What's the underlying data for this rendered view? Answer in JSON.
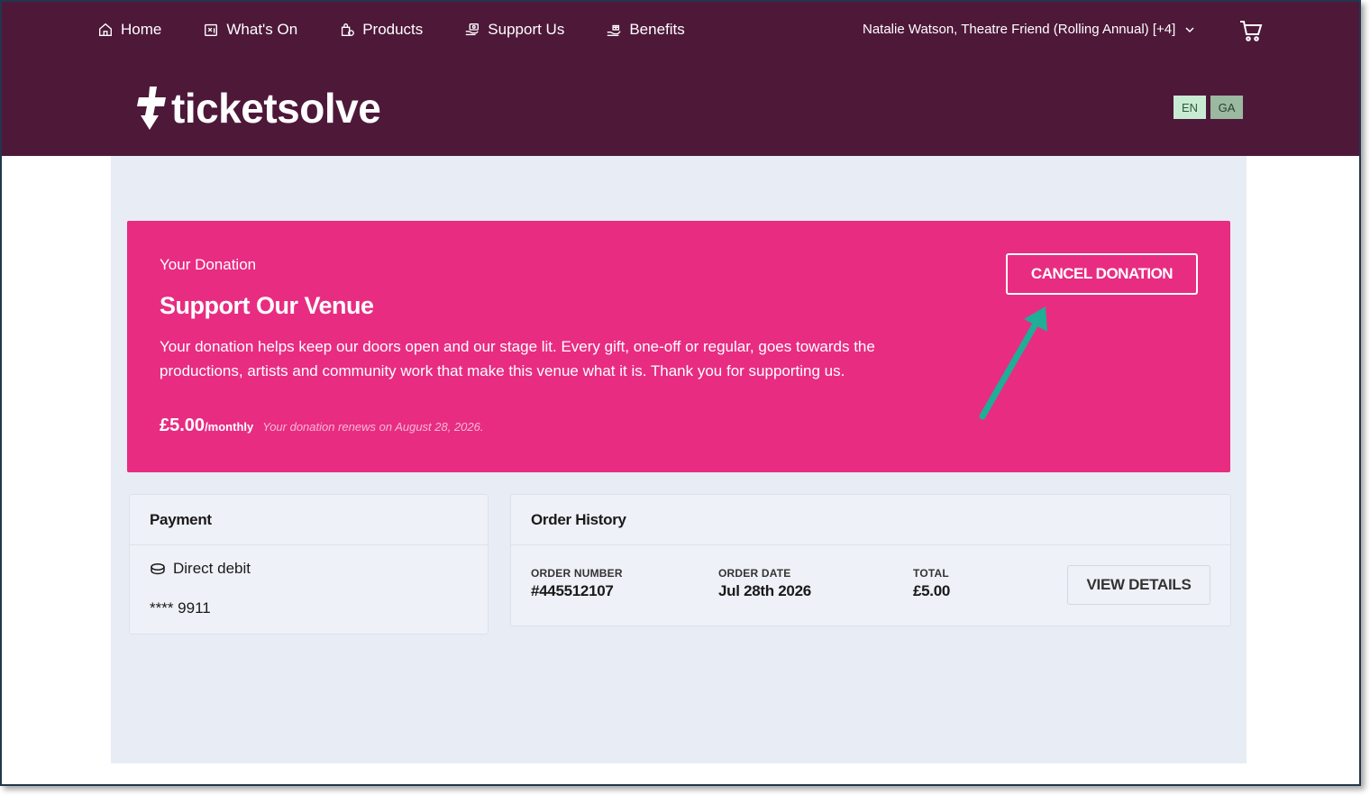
{
  "nav": {
    "items": [
      {
        "label": "Home",
        "icon": "home-icon"
      },
      {
        "label": "What's On",
        "icon": "calendar-icon"
      },
      {
        "label": "Products",
        "icon": "shopping-bag-icon"
      },
      {
        "label": "Support Us",
        "icon": "donate-icon"
      },
      {
        "label": "Benefits",
        "icon": "gift-hand-icon"
      }
    ],
    "user": "Natalie Watson, Theatre Friend (Rolling Annual) [+4]",
    "cart_icon": "cart-icon"
  },
  "brand": {
    "name": "ticketsolve",
    "header_bg": "#4e1839"
  },
  "languages": [
    "EN",
    "GA"
  ],
  "donation": {
    "label": "Your Donation",
    "title": "Support Our Venue",
    "description": "Your donation helps keep our doors open and our stage lit. Every gift, one-off or regular, goes towards the productions, artists and community work that make this venue what it is. Thank you for supporting us.",
    "amount": "£5.00",
    "period": "/monthly",
    "renewal": "Your donation renews on August 28, 2026.",
    "cancel_label": "CANCEL DONATION",
    "bg_color": "#e82c82",
    "annotation_color": "#1fae98"
  },
  "payment": {
    "title": "Payment",
    "method": "Direct debit",
    "card": "**** 9911"
  },
  "orders": {
    "title": "Order History",
    "columns": {
      "number_label": "ORDER NUMBER",
      "date_label": "ORDER DATE",
      "total_label": "TOTAL"
    },
    "row": {
      "number": "#445512107",
      "date": "Jul 28th 2026",
      "total": "£5.00"
    },
    "view_label": "VIEW DETAILS"
  }
}
